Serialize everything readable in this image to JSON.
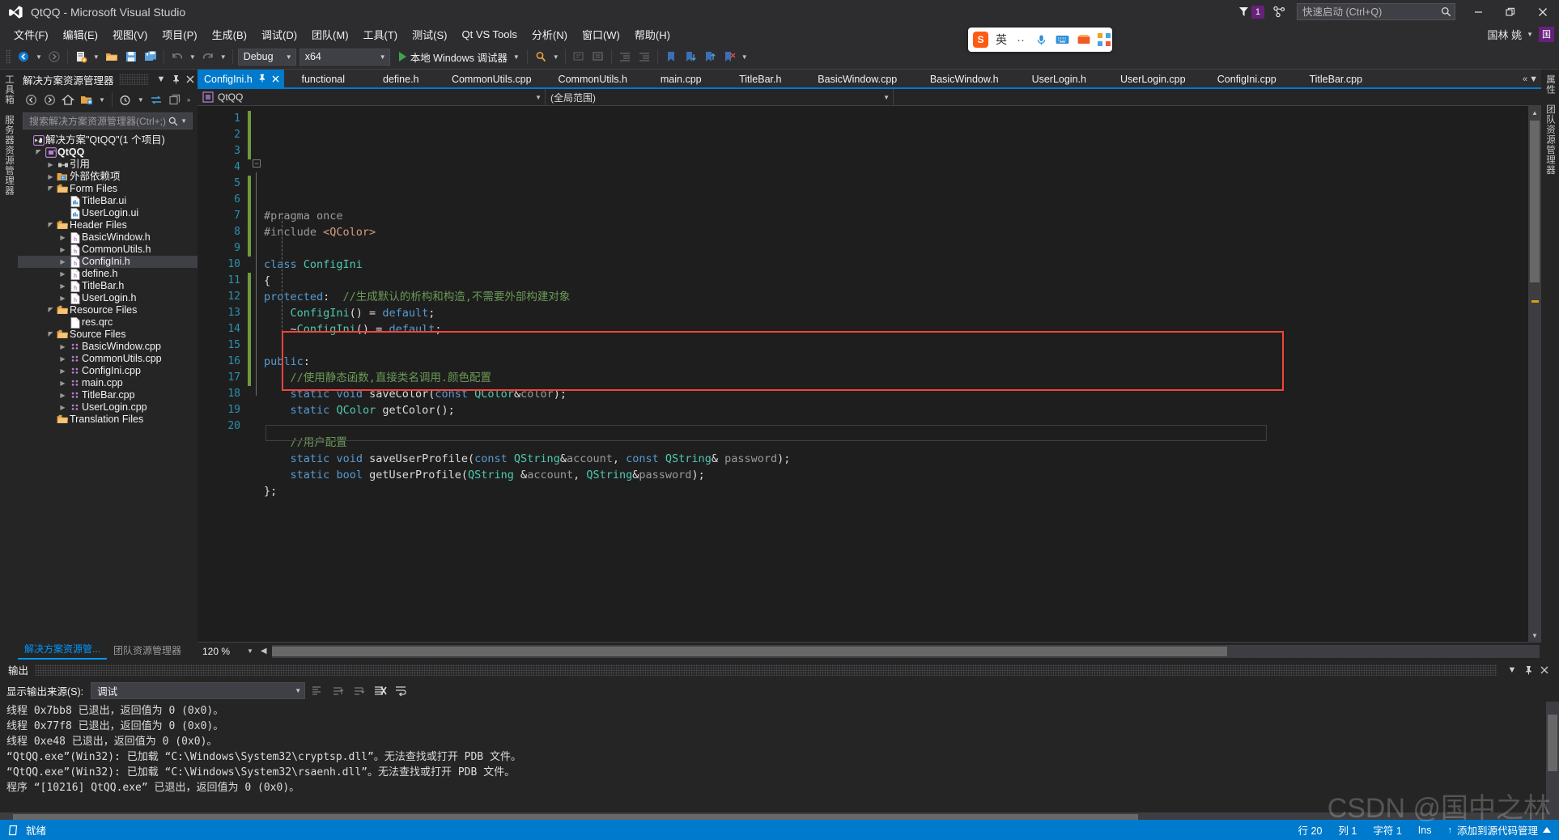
{
  "titlebar": {
    "app_title": "QtQQ - Microsoft Visual Studio",
    "notification_count": "1",
    "quick_launch_placeholder": "快速启动 (Ctrl+Q)",
    "minimize": "—",
    "restore": "❐",
    "close": "✕"
  },
  "menubar": {
    "items": [
      {
        "label": "文件(F)"
      },
      {
        "label": "编辑(E)"
      },
      {
        "label": "视图(V)"
      },
      {
        "label": "项目(P)"
      },
      {
        "label": "生成(B)"
      },
      {
        "label": "调试(D)"
      },
      {
        "label": "团队(M)"
      },
      {
        "label": "工具(T)"
      },
      {
        "label": "测试(S)"
      },
      {
        "label": "Qt VS Tools"
      },
      {
        "label": "分析(N)"
      },
      {
        "label": "窗口(W)"
      },
      {
        "label": "帮助(H)"
      }
    ],
    "user_name": "国林 姚",
    "user_initial": "国"
  },
  "toolbar": {
    "config_value": "Debug",
    "platform_value": "x64",
    "run_label": "本地 Windows 调试器"
  },
  "ime": {
    "logo_text": "S",
    "mode_label": "英",
    "dots": "··"
  },
  "left_edge_tabs": [
    "工具箱",
    "服务器资源管理器"
  ],
  "right_edge_tabs": [
    "属性",
    "团队资源管理器"
  ],
  "solution_explorer": {
    "title": "解决方案资源管理器",
    "search_placeholder": "搜索解决方案资源管理器(Ctrl+;)",
    "tree": [
      {
        "depth": 0,
        "arrow": "none",
        "icon": "solution-icon",
        "label": "解决方案\"QtQQ\"(1 个项目)",
        "bold": false,
        "selected": false
      },
      {
        "depth": 1,
        "arrow": "open",
        "icon": "project-icon",
        "label": "QtQQ",
        "bold": true,
        "selected": false
      },
      {
        "depth": 2,
        "arrow": "closed",
        "icon": "references-icon",
        "label": "引用",
        "bold": false,
        "selected": false
      },
      {
        "depth": 2,
        "arrow": "closed",
        "icon": "folder-ext-icon",
        "label": "外部依赖项",
        "bold": false,
        "selected": false
      },
      {
        "depth": 2,
        "arrow": "open",
        "icon": "filter-icon",
        "label": "Form Files",
        "bold": false,
        "selected": false
      },
      {
        "depth": 3,
        "arrow": "none",
        "icon": "ui-file-icon",
        "label": "TitleBar.ui",
        "bold": false,
        "selected": false
      },
      {
        "depth": 3,
        "arrow": "none",
        "icon": "ui-file-icon",
        "label": "UserLogin.ui",
        "bold": false,
        "selected": false
      },
      {
        "depth": 2,
        "arrow": "open",
        "icon": "filter-icon",
        "label": "Header Files",
        "bold": false,
        "selected": false
      },
      {
        "depth": 3,
        "arrow": "closed",
        "icon": "h-file-icon",
        "label": "BasicWindow.h",
        "bold": false,
        "selected": false
      },
      {
        "depth": 3,
        "arrow": "closed",
        "icon": "h-file-icon",
        "label": "CommonUtils.h",
        "bold": false,
        "selected": false
      },
      {
        "depth": 3,
        "arrow": "closed",
        "icon": "h-file-icon",
        "label": "ConfigIni.h",
        "bold": false,
        "selected": true
      },
      {
        "depth": 3,
        "arrow": "closed",
        "icon": "h-file-icon",
        "label": "define.h",
        "bold": false,
        "selected": false
      },
      {
        "depth": 3,
        "arrow": "closed",
        "icon": "h-file-icon",
        "label": "TitleBar.h",
        "bold": false,
        "selected": false
      },
      {
        "depth": 3,
        "arrow": "closed",
        "icon": "h-file-icon",
        "label": "UserLogin.h",
        "bold": false,
        "selected": false
      },
      {
        "depth": 2,
        "arrow": "open",
        "icon": "filter-icon",
        "label": "Resource Files",
        "bold": false,
        "selected": false
      },
      {
        "depth": 3,
        "arrow": "none",
        "icon": "qrc-file-icon",
        "label": "res.qrc",
        "bold": false,
        "selected": false
      },
      {
        "depth": 2,
        "arrow": "open",
        "icon": "filter-icon",
        "label": "Source Files",
        "bold": false,
        "selected": false
      },
      {
        "depth": 3,
        "arrow": "closed",
        "icon": "cpp-file-icon",
        "label": "BasicWindow.cpp",
        "bold": false,
        "selected": false
      },
      {
        "depth": 3,
        "arrow": "closed",
        "icon": "cpp-file-icon",
        "label": "CommonUtils.cpp",
        "bold": false,
        "selected": false
      },
      {
        "depth": 3,
        "arrow": "closed",
        "icon": "cpp-file-icon",
        "label": "ConfigIni.cpp",
        "bold": false,
        "selected": false
      },
      {
        "depth": 3,
        "arrow": "closed",
        "icon": "cpp-file-icon",
        "label": "main.cpp",
        "bold": false,
        "selected": false
      },
      {
        "depth": 3,
        "arrow": "closed",
        "icon": "cpp-file-icon",
        "label": "TitleBar.cpp",
        "bold": false,
        "selected": false
      },
      {
        "depth": 3,
        "arrow": "closed",
        "icon": "cpp-file-icon",
        "label": "UserLogin.cpp",
        "bold": false,
        "selected": false
      },
      {
        "depth": 2,
        "arrow": "none",
        "icon": "filter-icon",
        "label": "Translation Files",
        "bold": false,
        "selected": false
      }
    ],
    "bottom_tabs": [
      {
        "label": "解决方案资源管...",
        "active": true
      },
      {
        "label": "团队资源管理器",
        "active": false
      }
    ]
  },
  "editor": {
    "tabs": [
      {
        "label": "ConfigIni.h",
        "active": true
      },
      {
        "label": "functional",
        "active": false
      },
      {
        "label": "define.h",
        "active": false
      },
      {
        "label": "CommonUtils.cpp",
        "active": false
      },
      {
        "label": "CommonUtils.h",
        "active": false
      },
      {
        "label": "main.cpp",
        "active": false
      },
      {
        "label": "TitleBar.h",
        "active": false
      },
      {
        "label": "BasicWindow.cpp",
        "active": false
      },
      {
        "label": "BasicWindow.h",
        "active": false
      },
      {
        "label": "UserLogin.h",
        "active": false
      },
      {
        "label": "UserLogin.cpp",
        "active": false
      },
      {
        "label": "ConfigIni.cpp",
        "active": false
      },
      {
        "label": "TitleBar.cpp",
        "active": false
      }
    ],
    "nav_project": "QtQQ",
    "nav_scope": "(全局范围)",
    "zoom_level": "120 %",
    "line_numbers": [
      "1",
      "2",
      "3",
      "4",
      "5",
      "6",
      "7",
      "8",
      "9",
      "10",
      "11",
      "12",
      "13",
      "14",
      "15",
      "16",
      "17",
      "18",
      "19",
      "20"
    ],
    "code_lines": [
      {
        "n": 1,
        "html": "<span class=\"pp\">#pragma once</span>"
      },
      {
        "n": 2,
        "html": "<span class=\"pp\">#include </span><span class=\"str\">&lt;QColor&gt;</span>"
      },
      {
        "n": 3,
        "html": ""
      },
      {
        "n": 4,
        "html": "<span class=\"kw\">class</span> <span class=\"typ\">ConfigIni</span>"
      },
      {
        "n": 5,
        "html": "<span class=\"pln\">{</span>"
      },
      {
        "n": 6,
        "html": "<span class=\"kw\">protected</span><span class=\"pln\">:  </span><span class=\"cmt\">//生成默认的析构和构造,不需要外部构建对象</span>"
      },
      {
        "n": 7,
        "html": "<span class=\"pln\">    </span><span class=\"typ\">ConfigIni</span><span class=\"pln\">() = </span><span class=\"kw\">default</span><span class=\"pln\">;</span>"
      },
      {
        "n": 8,
        "html": "<span class=\"pln\">    ~</span><span class=\"typ\">ConfigIni</span><span class=\"pln\">() = </span><span class=\"kw\">default</span><span class=\"pln\">;</span>"
      },
      {
        "n": 9,
        "html": ""
      },
      {
        "n": 10,
        "html": "<span class=\"kw\">public</span><span class=\"pln\">:</span>"
      },
      {
        "n": 11,
        "html": "<span class=\"pln\">    </span><span class=\"cmt\">//使用静态函数,直接类名调用.颜色配置</span>"
      },
      {
        "n": 12,
        "html": "<span class=\"pln\">    </span><span class=\"kw\">static</span> <span class=\"kw\">void</span> <span class=\"pln\">saveColor(</span><span class=\"kw\">const</span> <span class=\"typ\">QColor</span><span class=\"pln\">&amp;</span><span class=\"param\">color</span><span class=\"pln\">);</span>"
      },
      {
        "n": 13,
        "html": "<span class=\"pln\">    </span><span class=\"kw\">static</span> <span class=\"typ\">QColor</span> <span class=\"pln\">getColor();</span>"
      },
      {
        "n": 14,
        "html": ""
      },
      {
        "n": 15,
        "html": "<span class=\"pln\">    </span><span class=\"cmt\">//用户配置</span>"
      },
      {
        "n": 16,
        "html": "<span class=\"pln\">    </span><span class=\"kw\">static</span> <span class=\"kw\">void</span> <span class=\"pln\">saveUserProfile(</span><span class=\"kw\">const</span> <span class=\"typ\">QString</span><span class=\"pln\">&amp;</span><span class=\"param\">account</span><span class=\"pln\">, </span><span class=\"kw\">const</span> <span class=\"typ\">QString</span><span class=\"pln\">&amp; </span><span class=\"param\">password</span><span class=\"pln\">);</span>"
      },
      {
        "n": 17,
        "html": "<span class=\"pln\">    </span><span class=\"kw\">static</span> <span class=\"kw\">bool</span> <span class=\"pln\">getUserProfile(</span><span class=\"typ\">QString</span><span class=\"pln\"> &amp;</span><span class=\"param\">account</span><span class=\"pln\">, </span><span class=\"typ\">QString</span><span class=\"pln\">&amp;</span><span class=\"param\">password</span><span class=\"pln\">);</span>"
      },
      {
        "n": 18,
        "html": "<span class=\"pln\">};</span>"
      },
      {
        "n": 19,
        "html": ""
      },
      {
        "n": 20,
        "html": ""
      }
    ],
    "code_plain": [
      "#pragma once",
      "#include <QColor>",
      "",
      "class ConfigIni",
      "{",
      "protected:  //生成默认的析构和构造,不需要外部构建对象",
      "    ConfigIni() = default;",
      "    ~ConfigIni() = default;",
      "",
      "public:",
      "    //使用静态函数,直接类名调用.颜色配置",
      "    static void saveColor(const QColor&color);",
      "    static QColor getColor();",
      "",
      "    //用户配置",
      "    static void saveUserProfile(const QString&account, const QString& password);",
      "    static bool getUserProfile(QString &account, QString&password);",
      "};",
      "",
      ""
    ],
    "highlight_color": "#f4433a"
  },
  "output_panel": {
    "title": "输出",
    "source_label": "显示输出来源(S):",
    "source_value": "调试",
    "lines": [
      "线程 0x7bb8 已退出，返回值为 0 (0x0)。",
      "线程 0x77f8 已退出，返回值为 0 (0x0)。",
      "线程 0xe48 已退出，返回值为 0 (0x0)。",
      "“QtQQ.exe”(Win32): 已加载 “C:\\Windows\\System32\\cryptsp.dll”。无法查找或打开 PDB 文件。",
      "“QtQQ.exe”(Win32): 已加载 “C:\\Windows\\System32\\rsaenh.dll”。无法查找或打开 PDB 文件。",
      "程序 “[10216] QtQQ.exe” 已退出，返回值为 0 (0x0)。"
    ]
  },
  "statusbar": {
    "ready": "就绪",
    "line_label": "行 20",
    "col_label": "列 1",
    "char_label": "字符 1",
    "insert_mode": "Ins",
    "source_control": "添加到源代码管理"
  },
  "watermark": "CSDN @国中之林",
  "colors": {
    "accent": "#007acc",
    "title_bg": "#2d2d30",
    "panel_bg": "#252526",
    "editor_bg": "#1e1e1e",
    "badge_purple": "#68217a",
    "highlight_red": "#f4433a"
  }
}
